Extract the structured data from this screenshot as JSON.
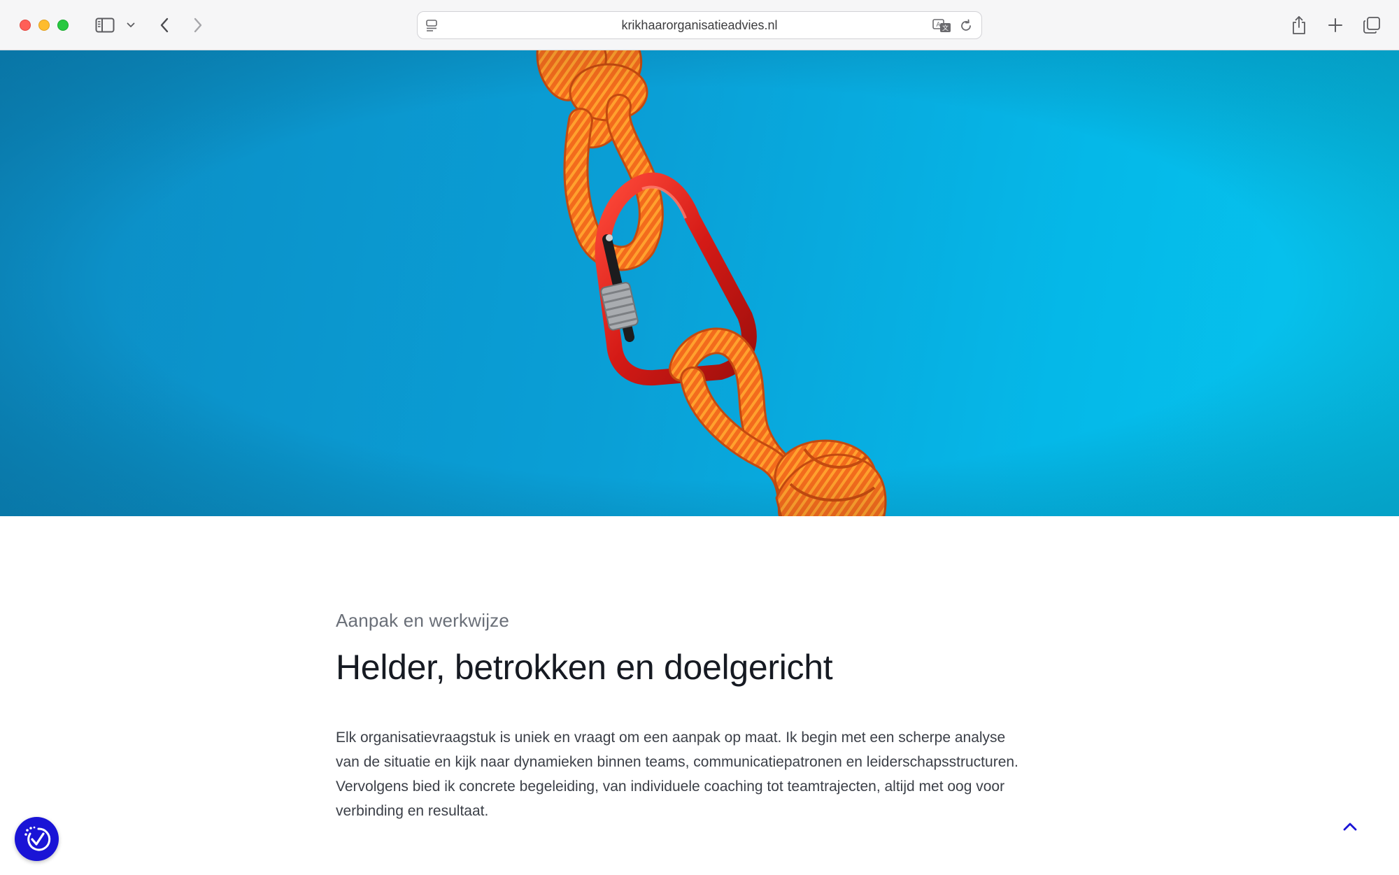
{
  "browser": {
    "url": "krikhaarorganisatieadvies.nl"
  },
  "hero": {
    "image": "climbing-rope-carabiner-photo",
    "background_color": "#0aa8de",
    "rope_color": "#f06a1f",
    "carabiner_color": "#d8201c"
  },
  "section": {
    "eyebrow": "Aanpak en werkwijze",
    "heading": "Helder, betrokken en doelgericht",
    "paragraph_lines": [
      "Elk organisatievraagstuk is uniek en vraagt om een aanpak op maat. Ik begin met een scherpe analyse",
      "van de situatie en kijk naar dynamieken binnen teams, communicatiepatronen en leiderschapsstructuren.",
      "Vervolgens bied ik concrete begeleiding, van individuele coaching tot teamtrajecten, altijd met oog voor",
      "verbinding en resultaat."
    ]
  },
  "widgets": {
    "accessibility_icon": "accessibility-check-icon",
    "accessibility_color": "#1a14d6",
    "scroll_top_icon": "chevron-up-icon"
  }
}
